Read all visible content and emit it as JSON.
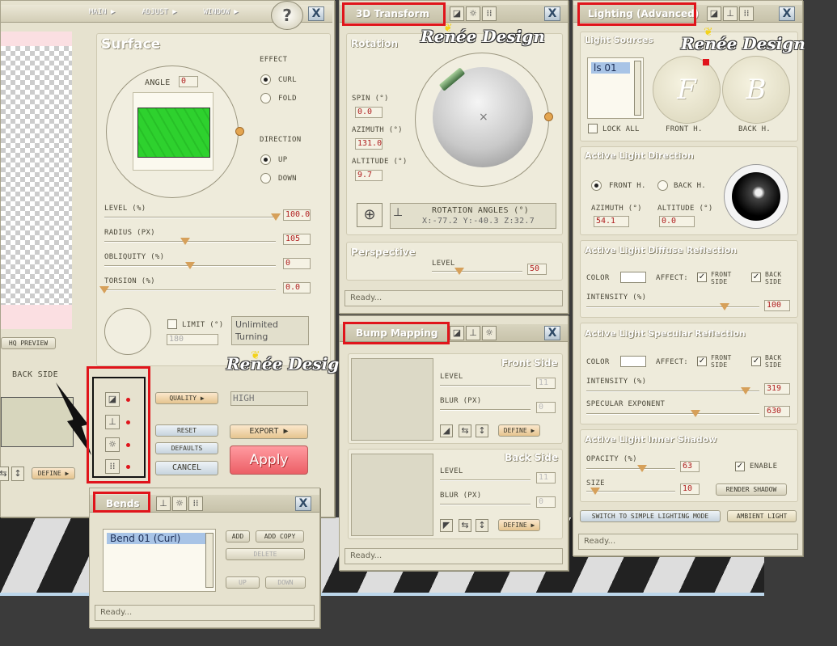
{
  "menu": {
    "main": "MAIN ▶",
    "adjust": "ADJUST ▶",
    "window": "WINDOW ▶",
    "help": "?",
    "close": "X"
  },
  "watermark": "Renée Design",
  "preview": {
    "hq_label": "HQ PREVIEW"
  },
  "surface": {
    "title": "Surface",
    "angle_label": "ANGLE",
    "angle_value": "0",
    "effect_label": "EFFECT",
    "curl": "CURL",
    "fold": "FOLD",
    "direction_label": "DIRECTION",
    "up": "UP",
    "down": "DOWN",
    "level_label": "LEVEL (%)",
    "level_value": "100.0",
    "radius_label": "RADIUS (PX)",
    "radius_value": "105",
    "obliquity_label": "OBLIQUITY (%)",
    "obliquity_value": "0",
    "torsion_label": "TORSION (%)",
    "torsion_value": "0.0",
    "limit_label": "LIMIT (°)",
    "limit_value": "180",
    "limit_text": "Unlimited Turning"
  },
  "back_side": {
    "label": "BACK SIDE",
    "define": "DEFINE ▶"
  },
  "actions": {
    "quality_label": "QUALITY ▶",
    "quality_value": "HIGH",
    "reset": "RESET",
    "defaults": "DEFAULTS",
    "cancel": "CANCEL",
    "export": "EXPORT ▶",
    "apply": "Apply"
  },
  "bends": {
    "title": "Bends",
    "item": "Bend 01 (Curl)",
    "add": "ADD",
    "add_copy": "ADD COPY",
    "delete": "DELETE",
    "up": "UP",
    "down": "DOWN",
    "status": "Ready..."
  },
  "transform": {
    "title": "3D Transform",
    "rotation": "Rotation",
    "spin_label": "SPIN (°)",
    "spin_value": "0.0",
    "azimuth_label": "AZIMUTH (°)",
    "azimuth_value": "131.0",
    "altitude_label": "ALTITUDE (°)",
    "altitude_value": "9.7",
    "rot_angles_label": "ROTATION ANGLES (°)",
    "rot_angles_value": "X:-77.2  Y:-40.3  Z:32.7",
    "perspective": "Perspective",
    "level_label": "LEVEL",
    "level_value": "50",
    "status": "Ready..."
  },
  "bump": {
    "title": "Bump Mapping",
    "front_side": "Front Side",
    "back_side": "Back Side",
    "level_label": "LEVEL",
    "front_level": "11",
    "blur_label": "BLUR (PX)",
    "front_blur": "0",
    "back_level": "11",
    "back_blur": "0",
    "define": "DEFINE ▶",
    "status": "Ready..."
  },
  "lighting": {
    "title": "Lighting (Advanced)",
    "light_sources": "Light Sources",
    "source_item": "ls 01",
    "lock_all": "LOCK ALL",
    "front_h": "FRONT H.",
    "back_h": "BACK H.",
    "front_letter": "F",
    "back_letter": "B",
    "direction_title": "Active Light Direction",
    "dir_front": "FRONT H.",
    "dir_back": "BACK H.",
    "azimuth_label": "AZIMUTH (°)",
    "azimuth_value": "54.1",
    "altitude_label": "ALTITUDE (°)",
    "altitude_value": "0.0",
    "diffuse_title": "Active Light Diffuse Reflection",
    "color_label": "COLOR",
    "affect_label": "AFFECT:",
    "front_side_1": "FRONT",
    "front_side_2": "SIDE",
    "back_side_1": "BACK",
    "back_side_2": "SIDE",
    "intensity_label": "INTENSITY (%)",
    "diffuse_intensity": "100",
    "specular_title": "Active Light Specular Reflection",
    "specular_intensity": "319",
    "specular_exp_label": "SPECULAR EXPONENT",
    "specular_exp": "630",
    "shadow_title": "Active Light Inner Shadow",
    "opacity_label": "OPACITY (%)",
    "opacity_value": "63",
    "enable": "ENABLE",
    "size_label": "SIZE",
    "size_value": "10",
    "render_shadow": "RENDER SHADOW",
    "switch_mode": "SWITCH TO SIMPLE LIGHTING MODE",
    "ambient": "AMBIENT LIGHT",
    "status": "Ready..."
  },
  "colors": {
    "highlight": "#e0141b",
    "preview_green": "#2ed12e",
    "pink": "#fbdfe2"
  },
  "sliders": {
    "level": 1.0,
    "radius": 0.47,
    "obliquity": 0.5,
    "torsion": 0.0,
    "perspective": 0.3,
    "diffuse": 0.8,
    "specular": 0.92,
    "specular_exp": 0.63,
    "opacity": 0.63,
    "size": 0.1
  }
}
